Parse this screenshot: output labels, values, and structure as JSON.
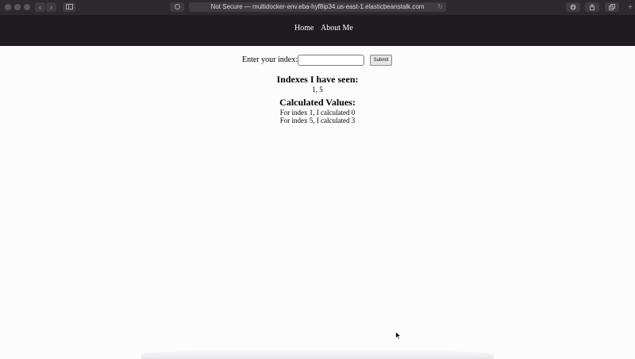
{
  "browser": {
    "address": "Not Secure — multidocker-env.eba-hyf8ip34.us-east-1.elasticbeanstalk.com",
    "back_icon": "‹",
    "forward_icon": "›",
    "reload_icon": "↻",
    "new_tab_icon": "+"
  },
  "nav": {
    "links": [
      {
        "label": "Home"
      },
      {
        "label": "About Me"
      }
    ]
  },
  "form": {
    "label": "Enter your index:",
    "input_value": "",
    "submit_label": "Submit"
  },
  "indexes": {
    "heading": "Indexes I have seen:",
    "values": "1, 5"
  },
  "calculated": {
    "heading": "Calculated Values:",
    "lines": [
      "For index 1, I calculated 0",
      "For index 5, I calculated 3"
    ]
  }
}
